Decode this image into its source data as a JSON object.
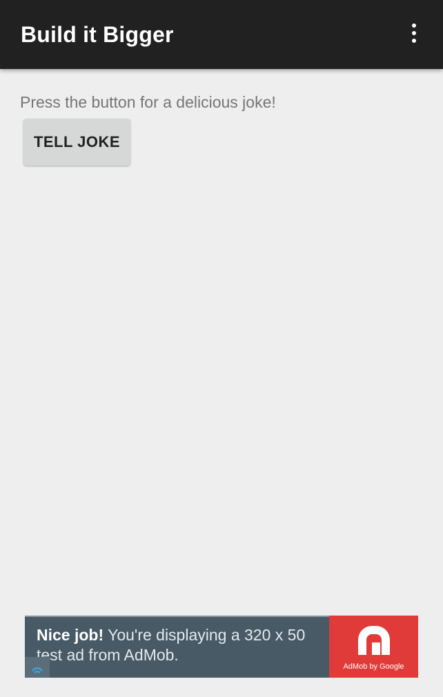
{
  "app_bar": {
    "title": "Build it Bigger",
    "overflow_icon": "more-vert-icon"
  },
  "main": {
    "instructions": "Press the button for a delicious joke!",
    "tell_joke_label": "TELL JOKE"
  },
  "ad": {
    "headline": "Nice job!",
    "body": "You're displaying a 320 x 50 test ad from AdMob.",
    "logo_caption": "AdMob by Google",
    "logo_icon": "admob-logo-icon",
    "info_icon": "adchoices-icon"
  },
  "colors": {
    "app_bar": "#212121",
    "background": "#eeeeee",
    "button": "#d6d7d7",
    "ad_background": "#475a66",
    "admob_red": "#e03b39"
  }
}
